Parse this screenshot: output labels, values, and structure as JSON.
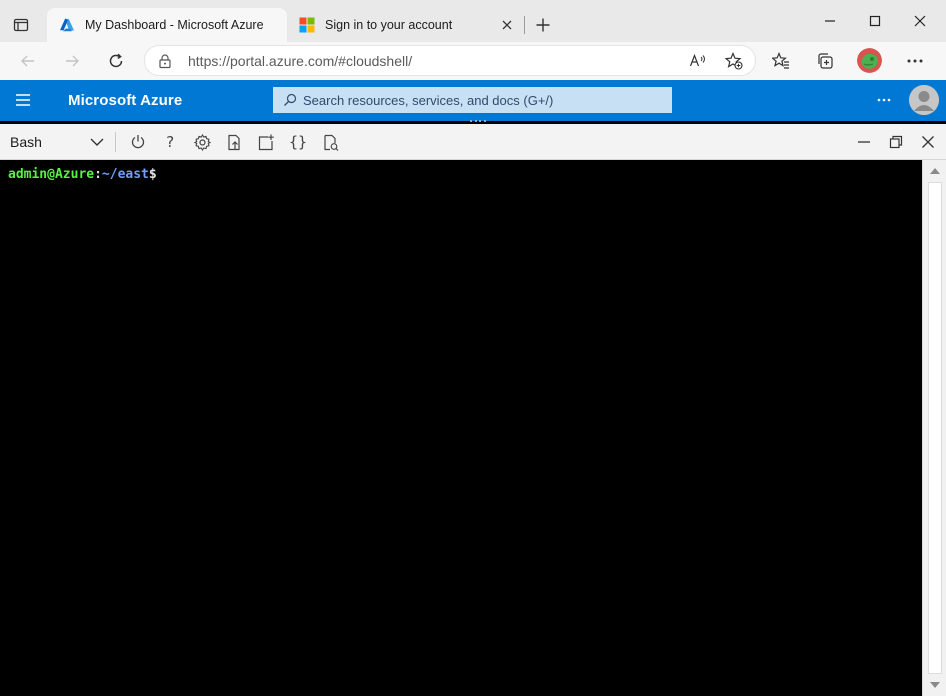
{
  "browser": {
    "tabs": [
      {
        "title": "My Dashboard - Microsoft Azure",
        "active": true,
        "favicon": "azure-logo-icon"
      },
      {
        "title": "Sign in to your account",
        "active": false,
        "favicon": "microsoft-logo-icon"
      }
    ],
    "address": {
      "url": "https://portal.azure.com/#cloudshell/"
    },
    "colors": {
      "tabstrip": "#e9e9e9",
      "toolbar": "#f7f7f7"
    }
  },
  "portal": {
    "brand": "Microsoft Azure",
    "search_placeholder": "Search resources, services, and docs (G+/)",
    "colors": {
      "header": "#0078d4",
      "search_bg": "#c7e0f4"
    }
  },
  "cloudshell": {
    "shell_type": "Bash",
    "toolbar_icons": [
      "power-icon",
      "help-icon",
      "settings-icon",
      "upload-download-icon",
      "new-session-icon",
      "braces-icon",
      "web-preview-icon"
    ],
    "help_label": "?",
    "braces_label": "{}",
    "prompt": {
      "user_host": "admin@Azure",
      "separator": ":",
      "path": "~/east",
      "symbol": "$"
    },
    "colors": {
      "user": "#5af046",
      "path": "#6f9fff",
      "background": "#000000"
    }
  }
}
